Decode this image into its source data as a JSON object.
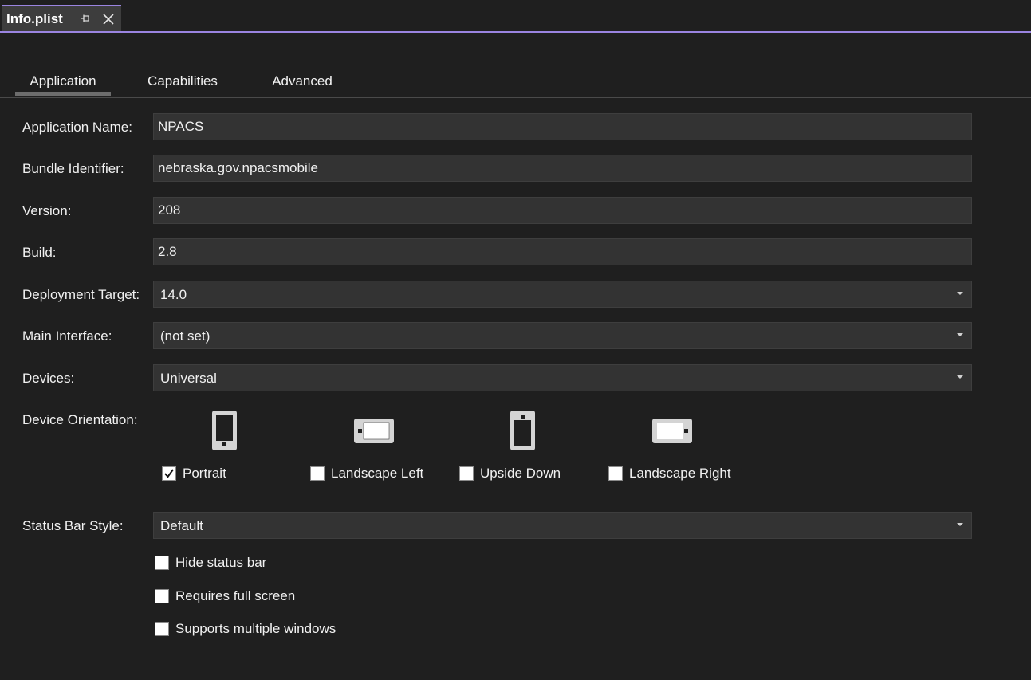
{
  "document_tab": {
    "title": "Info.plist",
    "pin_icon": "pin-icon",
    "close_icon": "close-icon"
  },
  "colors": {
    "accent": "#9a84e0",
    "background": "#1f1f1f",
    "field_background": "#333333"
  },
  "tabs": [
    {
      "label": "Application",
      "selected": true
    },
    {
      "label": "Capabilities",
      "selected": false
    },
    {
      "label": "Advanced",
      "selected": false
    }
  ],
  "form": {
    "application_name": {
      "label": "Application Name:",
      "value": "NPACS"
    },
    "bundle_identifier": {
      "label": "Bundle Identifier:",
      "value": "nebraska.gov.npacsmobile"
    },
    "version": {
      "label": "Version:",
      "value": "208"
    },
    "build": {
      "label": "Build:",
      "value": "2.8"
    },
    "deployment_target": {
      "label": "Deployment Target:",
      "value": "14.0"
    },
    "main_interface": {
      "label": "Main Interface:",
      "value": "(not set)"
    },
    "devices": {
      "label": "Devices:",
      "value": "Universal"
    },
    "device_orientation": {
      "label": "Device Orientation:",
      "options": [
        {
          "label": "Portrait",
          "checked": true,
          "icon": "phone-portrait-icon"
        },
        {
          "label": "Landscape Left",
          "checked": false,
          "icon": "phone-landscape-left-icon"
        },
        {
          "label": "Upside Down",
          "checked": false,
          "icon": "phone-upside-down-icon"
        },
        {
          "label": "Landscape Right",
          "checked": false,
          "icon": "phone-landscape-right-icon"
        }
      ]
    },
    "status_bar_style": {
      "label": "Status Bar Style:",
      "value": "Default"
    },
    "status_options": [
      {
        "label": "Hide status bar",
        "checked": false
      },
      {
        "label": "Requires full screen",
        "checked": false
      },
      {
        "label": "Supports multiple windows",
        "checked": false
      }
    ]
  }
}
